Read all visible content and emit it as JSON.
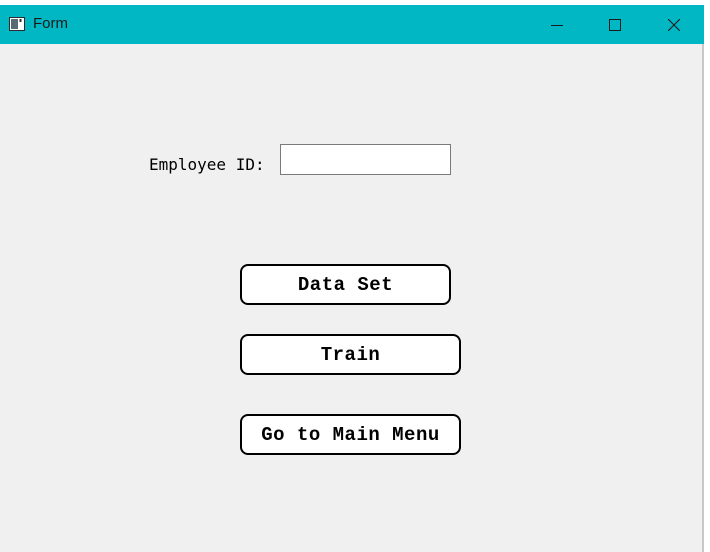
{
  "window": {
    "title": "Form",
    "titlebar_color": "#00b7c3",
    "icons": {
      "app": "form-app-icon",
      "minimize": "minimize-icon",
      "maximize": "maximize-icon",
      "close": "close-icon"
    }
  },
  "form": {
    "employee_id_label": "Employee ID:",
    "employee_id_value": "",
    "buttons": {
      "data_set": "Data Set",
      "train": "Train",
      "main_menu": "Go to Main Menu"
    }
  }
}
